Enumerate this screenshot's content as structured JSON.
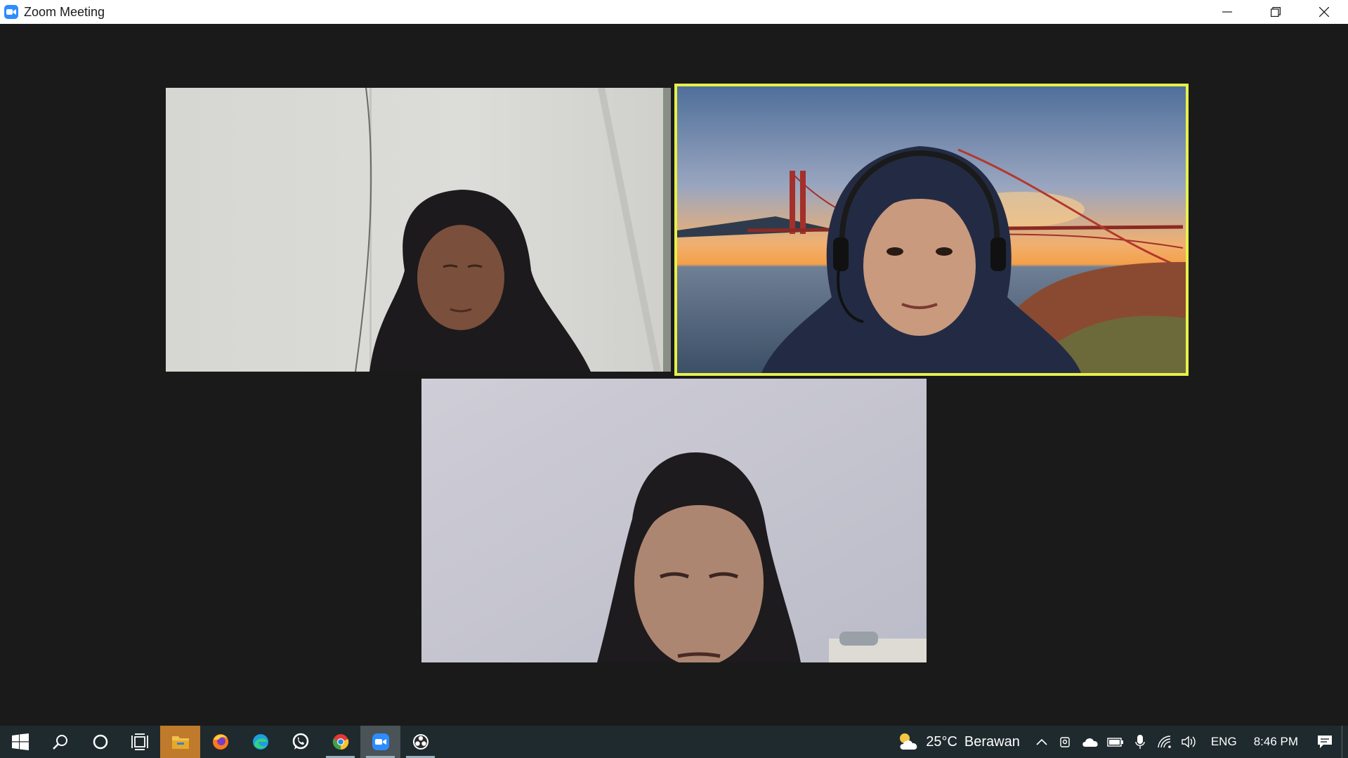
{
  "window": {
    "title": "Zoom Meeting",
    "controls": {
      "minimize": "minimize-icon",
      "restore": "restore-icon",
      "close": "close-icon"
    }
  },
  "meeting": {
    "active_speaker_color": "#e6f04a",
    "participants": [
      {
        "tile": "participant-video-1",
        "background": "plain wall",
        "active_speaker": false
      },
      {
        "tile": "participant-video-2",
        "background": "golden gate bridge virtual background",
        "active_speaker": true
      },
      {
        "tile": "participant-video-3",
        "background": "plain wall",
        "active_speaker": false
      }
    ]
  },
  "taskbar": {
    "apps": [
      {
        "name": "start-icon"
      },
      {
        "name": "search-icon"
      },
      {
        "name": "cortana-icon"
      },
      {
        "name": "task-view-icon"
      },
      {
        "name": "file-explorer-icon"
      },
      {
        "name": "firefox-icon"
      },
      {
        "name": "edge-icon"
      },
      {
        "name": "whatsapp-icon"
      },
      {
        "name": "chrome-icon"
      },
      {
        "name": "zoom-icon"
      },
      {
        "name": "obs-icon"
      }
    ],
    "tray": {
      "weather_temp": "25°C",
      "weather_desc": "Berawan",
      "language": "ENG",
      "time": "8:46 PM"
    }
  }
}
